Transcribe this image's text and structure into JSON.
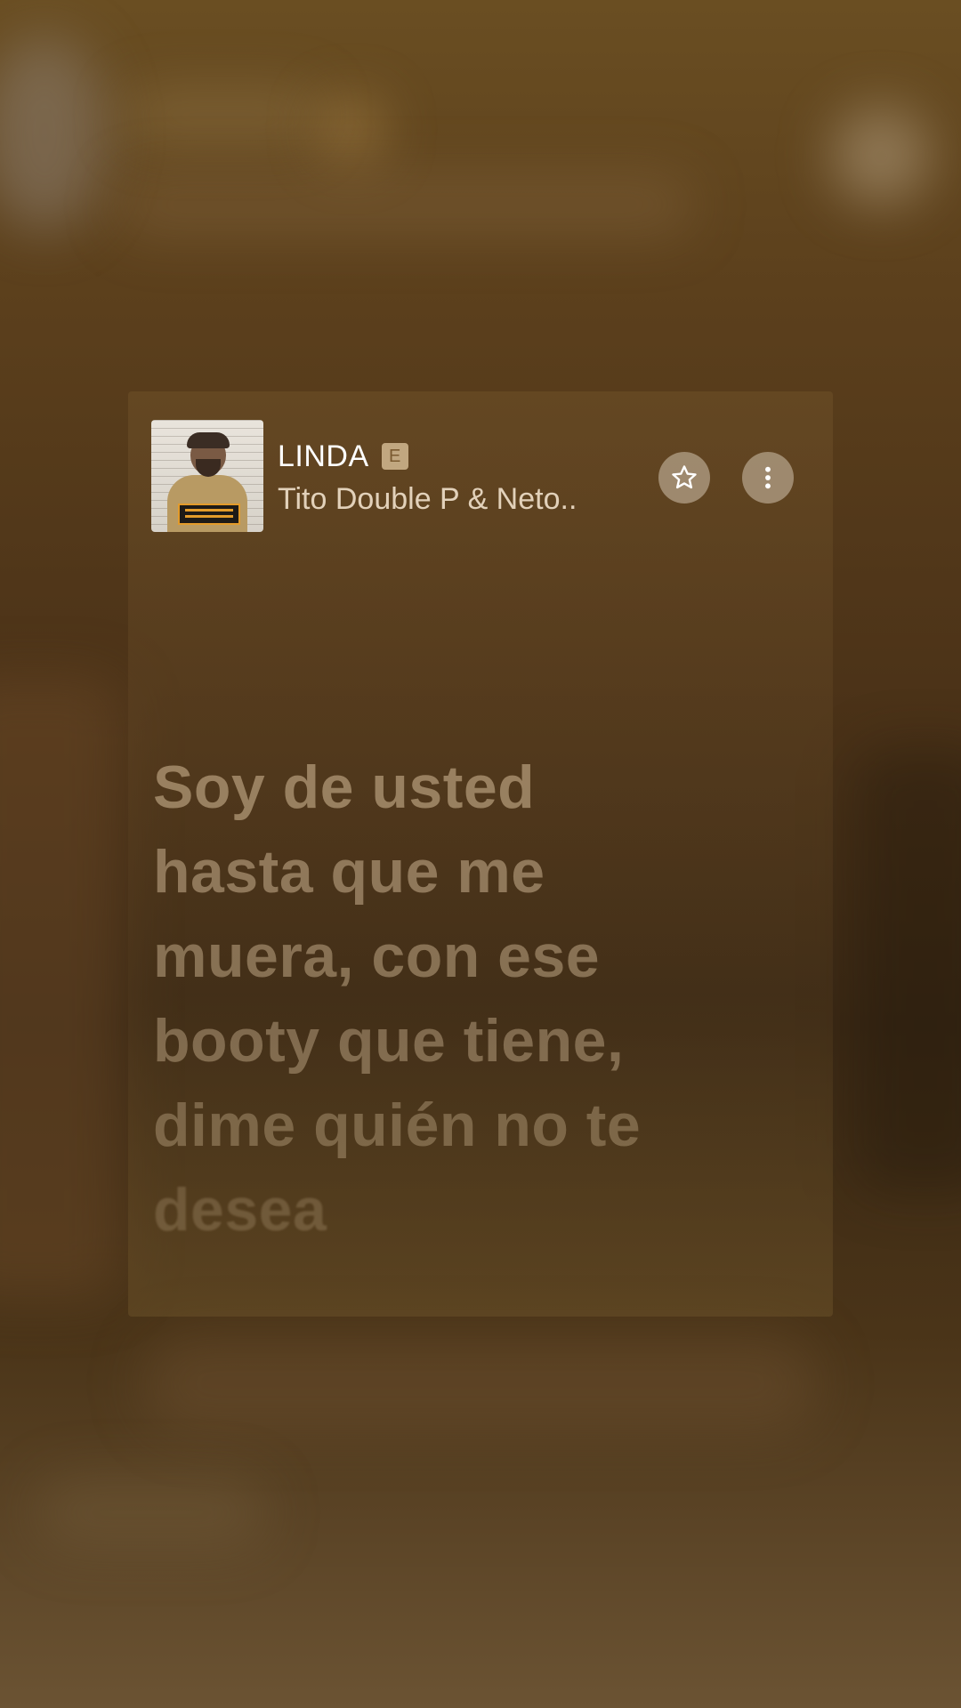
{
  "track": {
    "title": "LINDA",
    "explicit_badge": "E",
    "artist": "Tito Double P & Neto.."
  },
  "actions": {
    "favorite_icon": "star-outline-icon",
    "more_icon": "vertical-ellipsis-icon"
  },
  "lyrics": {
    "lines": [
      "Soy de usted",
      "hasta que me",
      "muera, con ese",
      "booty que tiene,",
      "dime quién no te",
      "desea"
    ]
  },
  "colors": {
    "background": "#4c3318",
    "card": "#6e5028",
    "lyric_text": "#dcc3a0",
    "button_bg": "#d2c3af"
  }
}
